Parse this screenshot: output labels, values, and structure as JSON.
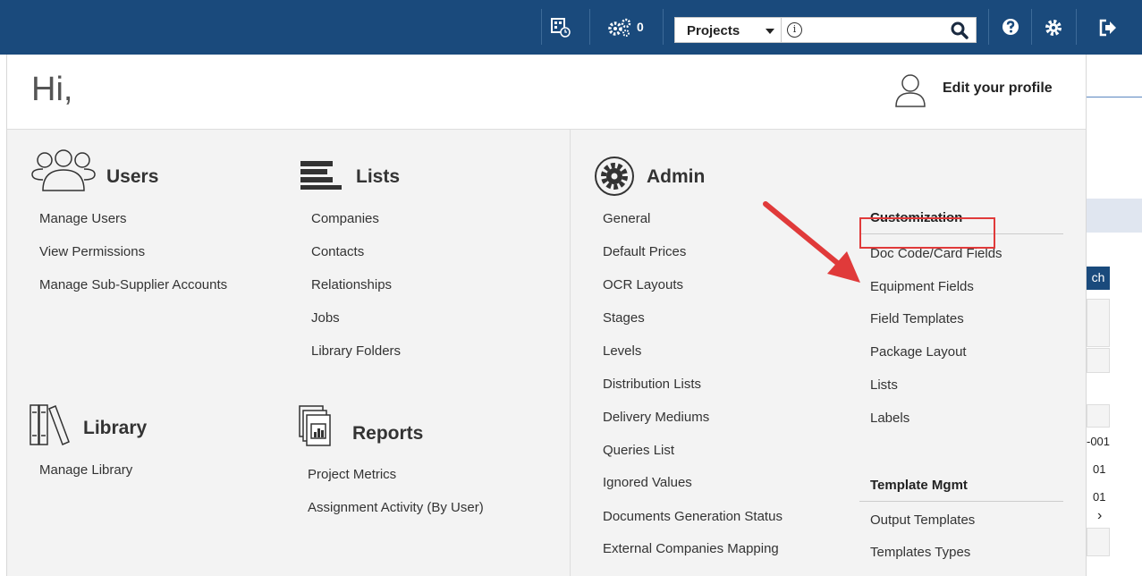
{
  "topbar": {
    "notifications_count": "0",
    "scope_select": "Projects",
    "search_value": ""
  },
  "profile": {
    "greeting": "Hi,",
    "edit_label": "Edit your profile"
  },
  "sections": {
    "users": {
      "title": "Users",
      "items": [
        "Manage Users",
        "View Permissions",
        "Manage Sub-Supplier Accounts"
      ]
    },
    "lists": {
      "title": "Lists",
      "items": [
        "Companies",
        "Contacts",
        "Relationships",
        "Jobs",
        "Library Folders"
      ]
    },
    "library": {
      "title": "Library",
      "items": [
        "Manage Library"
      ]
    },
    "reports": {
      "title": "Reports",
      "items": [
        "Project Metrics",
        "Assignment Activity (By User)"
      ]
    },
    "admin": {
      "title": "Admin",
      "items": [
        "General",
        "Default Prices",
        "OCR Layouts",
        "Stages",
        "Levels",
        "Distribution Lists",
        "Delivery Mediums",
        "Queries List",
        "Ignored Values",
        "Documents Generation Status",
        "External Companies Mapping"
      ]
    },
    "customization": {
      "title": "Customization",
      "items": [
        "Doc Code/Card Fields",
        "Equipment Fields",
        "Field Templates",
        "Package Layout",
        "Lists",
        "Labels"
      ]
    },
    "template_mgmt": {
      "title": "Template Mgmt",
      "items": [
        "Output Templates",
        "Templates Types"
      ]
    }
  },
  "background": {
    "button_fragment": "ch",
    "cell_1": "-001",
    "cell_2": "01",
    "cell_3": "01",
    "chevron": "›"
  },
  "colors": {
    "topbar": "#1a4a7c",
    "highlight": "#e03a3a"
  }
}
